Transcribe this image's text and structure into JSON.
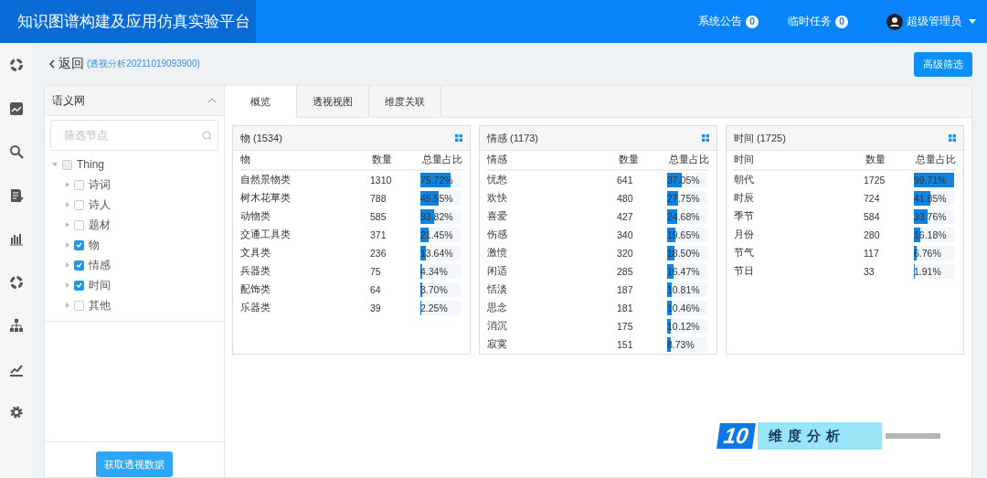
{
  "app": {
    "title": "知识图谱构建及应用仿真实验平台"
  },
  "header_links": [
    {
      "label": "系统公告",
      "count": "0"
    },
    {
      "label": "临时任务",
      "count": "0"
    }
  ],
  "user": {
    "name": "超级管理员"
  },
  "breadcrumb": {
    "back": "返回",
    "subtitle": "(透视分析20211019093900)"
  },
  "filter_button": "高级筛选",
  "tree_panel": {
    "title": "语义网",
    "search": {
      "placeholder": "筛选节点"
    },
    "tree": [
      {
        "label": "Thing",
        "checked": false,
        "expanded": true,
        "children": [
          {
            "label": "诗词",
            "checked": false,
            "expanded": false
          },
          {
            "label": "诗人",
            "checked": false,
            "expanded": false
          },
          {
            "label": "题材",
            "checked": false,
            "expanded": false
          },
          {
            "label": "物",
            "checked": true,
            "expanded": false
          },
          {
            "label": "情感",
            "checked": true,
            "expanded": false
          },
          {
            "label": "时间",
            "checked": true,
            "expanded": false
          },
          {
            "label": "其他",
            "checked": false,
            "expanded": false
          }
        ]
      }
    ],
    "action_button": "获取透视数据"
  },
  "tabs": [
    {
      "label": "概览",
      "selected": true
    },
    {
      "label": "透视视图",
      "selected": false
    },
    {
      "label": "维度关联",
      "selected": false
    }
  ],
  "cards": [
    {
      "title": "物",
      "count": "(1534)",
      "columns": [
        "物",
        "数量",
        "总量占比"
      ],
      "rows": [
        {
          "name": "自然景物类",
          "count": "1310",
          "percent": "75.72%",
          "level": 0.7572
        },
        {
          "name": "树木花草类",
          "count": "788",
          "percent": "45.55%",
          "level": 0.4555
        },
        {
          "name": "动物类",
          "count": "585",
          "percent": "33.82%",
          "level": 0.3382
        },
        {
          "name": "交通工具类",
          "count": "371",
          "percent": "21.45%",
          "level": 0.2145
        },
        {
          "name": "文具类",
          "count": "236",
          "percent": "13.64%",
          "level": 0.1364
        },
        {
          "name": "兵器类",
          "count": "75",
          "percent": "4.34%",
          "level": 0.0434
        },
        {
          "name": "配饰类",
          "count": "64",
          "percent": "3.70%",
          "level": 0.037
        },
        {
          "name": "乐器类",
          "count": "39",
          "percent": "2.25%",
          "level": 0.0225
        }
      ]
    },
    {
      "title": "情感",
      "count": "(1173)",
      "columns": [
        "情感",
        "数量",
        "总量占比"
      ],
      "rows": [
        {
          "name": "忧愁",
          "count": "641",
          "percent": "37.05%",
          "level": 0.3705
        },
        {
          "name": "欢快",
          "count": "480",
          "percent": "27.75%",
          "level": 0.2775
        },
        {
          "name": "喜爱",
          "count": "427",
          "percent": "24.68%",
          "level": 0.2468
        },
        {
          "name": "伤感",
          "count": "340",
          "percent": "19.65%",
          "level": 0.1965
        },
        {
          "name": "激愤",
          "count": "320",
          "percent": "18.50%",
          "level": 0.185
        },
        {
          "name": "闲适",
          "count": "285",
          "percent": "16.47%",
          "level": 0.1647
        },
        {
          "name": "恬淡",
          "count": "187",
          "percent": "10.81%",
          "level": 0.1081
        },
        {
          "name": "思念",
          "count": "181",
          "percent": "10.46%",
          "level": 0.1046
        },
        {
          "name": "消沉",
          "count": "175",
          "percent": "10.12%",
          "level": 0.1012
        },
        {
          "name": "寂寞",
          "count": "151",
          "percent": "8.73%",
          "level": 0.0873
        }
      ]
    },
    {
      "title": "时间",
      "count": "(1725)",
      "columns": [
        "时间",
        "数量",
        "总量占比"
      ],
      "rows": [
        {
          "name": "朝代",
          "count": "1725",
          "percent": "99.71%",
          "level": 0.9971
        },
        {
          "name": "时辰",
          "count": "724",
          "percent": "41.85%",
          "level": 0.4185
        },
        {
          "name": "季节",
          "count": "584",
          "percent": "33.76%",
          "level": 0.3376
        },
        {
          "name": "月份",
          "count": "280",
          "percent": "16.18%",
          "level": 0.1618
        },
        {
          "name": "节气",
          "count": "117",
          "percent": "6.76%",
          "level": 0.0676
        },
        {
          "name": "节日",
          "count": "33",
          "percent": "1.91%",
          "level": 0.0191
        }
      ]
    }
  ],
  "caption": {
    "number": "10",
    "text": "维度分析"
  }
}
